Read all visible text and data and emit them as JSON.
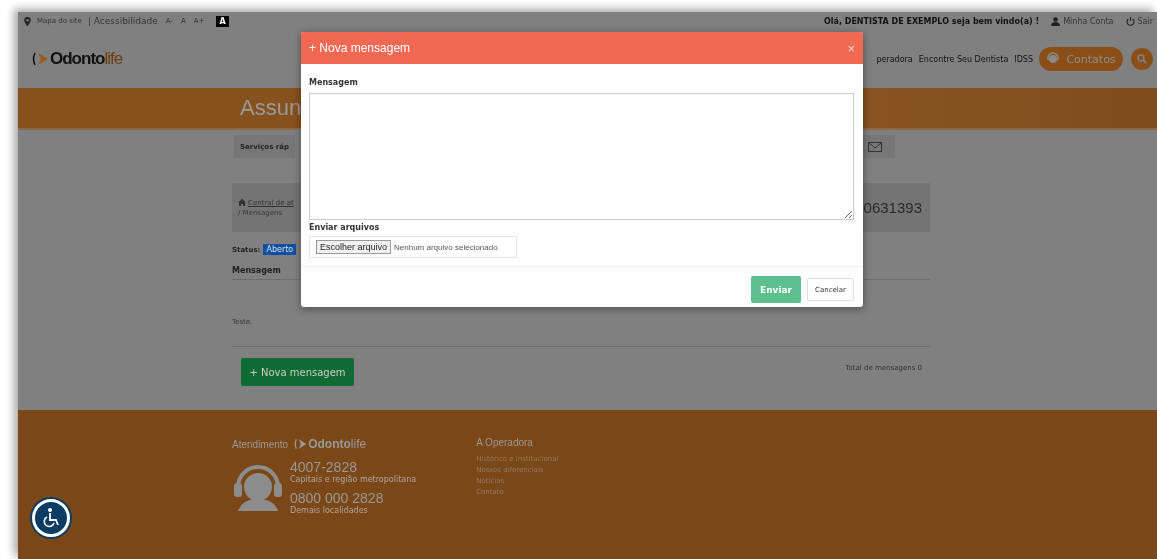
{
  "top_bar": {
    "site_map": "Mapa do site",
    "accessibility": "| Acessibilidade",
    "font_buttons": [
      "A-",
      "A",
      "A+"
    ],
    "contrast_button": "A",
    "greeting": "Olá, DENTISTA DE EXEMPLO seja bem vindo(a) !",
    "account": "Minha Conta",
    "logout": "Sair"
  },
  "header": {
    "logo": {
      "name": "Odonto",
      "suffix": "life"
    },
    "nav": [
      "peradora",
      "Encontre Seu Dentista",
      "IDSS"
    ],
    "contacts_button": "Contatos"
  },
  "banner": {
    "title": "Assun"
  },
  "quick_services": {
    "label": "Serviços ráp"
  },
  "breadcrumb": {
    "items": [
      "Central de at",
      "/ Mensagens"
    ],
    "number": "0631393"
  },
  "status": {
    "label": "Status:",
    "badge": "Aberto"
  },
  "messages": {
    "heading": "Mensagem",
    "items": [
      "Teste."
    ],
    "new_button": "+ Nova mensagem",
    "total": "Total de mensagens 0"
  },
  "footer": {
    "service_label": "Atendimento",
    "logo": {
      "name": "Odonto",
      "suffix": "life"
    },
    "phones": [
      {
        "number": "4007-2828",
        "note": "Capitais e região metropolitana"
      },
      {
        "number": "0800 000 2828",
        "note": "Demais localidades"
      }
    ],
    "operator_title": "A Operadora",
    "operator_links": [
      "Histórico e institucional",
      "Nossos diferenciais",
      "Notícias",
      "Contato"
    ]
  },
  "modal": {
    "title": "+ Nova mensagem",
    "close": "×",
    "message_label": "Mensagem",
    "files_label": "Enviar arquivos",
    "file_button": "Escolher arquivo",
    "file_status": "Nenhum arquivo selecionado",
    "submit": "Enviar",
    "cancel": "Cancelar"
  }
}
